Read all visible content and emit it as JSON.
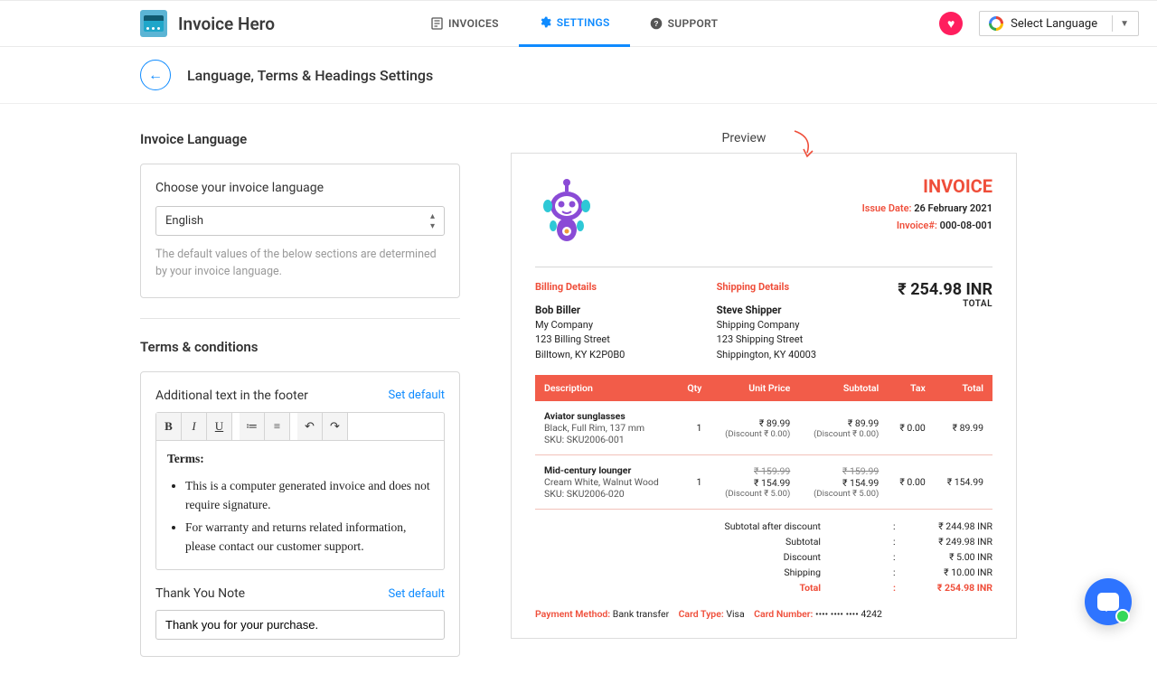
{
  "brand": {
    "name": "Invoice Hero"
  },
  "nav": {
    "invoices": "INVOICES",
    "settings": "SETTINGS",
    "support": "SUPPORT"
  },
  "language_selector_label": "Select Language",
  "subheading": "Language, Terms & Headings Settings",
  "sections": {
    "invoice_language": {
      "title": "Invoice Language",
      "label": "Choose your invoice language",
      "value": "English",
      "help": "The default values of the below sections are determined by your invoice language."
    },
    "terms": {
      "title": "Terms & conditions",
      "footer_label": "Additional text in the footer",
      "set_default": "Set default",
      "editor": {
        "heading": "Terms:",
        "bullets": [
          "This is a computer generated invoice and does not require signature.",
          "For warranty and returns related information, please contact our customer support."
        ]
      },
      "thank_you_label": "Thank You Note",
      "thank_you_value": "Thank you for your purchase."
    }
  },
  "preview_label": "Preview",
  "invoice": {
    "title": "INVOICE",
    "issue_date_label": "Issue Date:",
    "issue_date": "26 February 2021",
    "number_label": "Invoice#:",
    "number": "000-08-001",
    "billing": {
      "heading": "Billing Details",
      "name": "Bob Biller",
      "company": "My Company",
      "street": "123 Billing Street",
      "city": "Billtown, KY K2P0B0"
    },
    "shipping": {
      "heading": "Shipping Details",
      "name": "Steve Shipper",
      "company": "Shipping Company",
      "street": "123 Shipping Street",
      "city": "Shippington, KY 40003"
    },
    "grand_total": "₹ 254.98 INR",
    "grand_total_label": "TOTAL",
    "columns": {
      "description": "Description",
      "qty": "Qty",
      "unit_price": "Unit Price",
      "subtotal": "Subtotal",
      "tax": "Tax",
      "total": "Total"
    },
    "items": [
      {
        "name": "Aviator sunglasses",
        "variant": "Black, Full Rim, 137 mm",
        "sku": "SKU: SKU2006-001",
        "qty": "1",
        "unit_strike": "",
        "unit": "₹ 89.99",
        "unit_disc": "(Discount ₹ 0.00)",
        "sub_strike": "",
        "sub": "₹ 89.99",
        "sub_disc": "(Discount ₹ 0.00)",
        "tax": "₹ 0.00",
        "total": "₹ 89.99"
      },
      {
        "name": "Mid-century lounger",
        "variant": "Cream White, Walnut Wood",
        "sku": "SKU: SKU2006-020",
        "qty": "1",
        "unit_strike": "₹ 159.99",
        "unit": "₹ 154.99",
        "unit_disc": "(Discount ₹ 5.00)",
        "sub_strike": "₹ 159.99",
        "sub": "₹ 154.99",
        "sub_disc": "(Discount ₹ 5.00)",
        "tax": "₹ 0.00",
        "total": "₹ 154.99"
      }
    ],
    "summary": {
      "rows": [
        {
          "label": "Subtotal after discount",
          "value": "₹ 244.98 INR"
        },
        {
          "label": "Subtotal",
          "value": "₹ 249.98 INR"
        },
        {
          "label": "Discount",
          "value": "₹ 5.00 INR"
        },
        {
          "label": "Shipping",
          "value": "₹ 10.00 INR"
        }
      ],
      "total_label": "Total",
      "total_value": "₹ 254.98 INR"
    },
    "payment": {
      "method_label": "Payment Method:",
      "method": "Bank transfer",
      "card_type_label": "Card Type:",
      "card_type": "Visa",
      "card_number_label": "Card Number:",
      "card_number": "•••• •••• •••• 4242"
    }
  }
}
